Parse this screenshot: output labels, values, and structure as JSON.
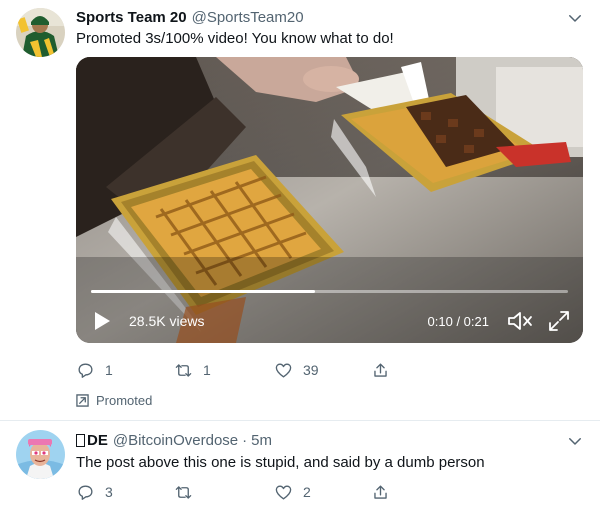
{
  "tweets": [
    {
      "author_name": "Sports Team 20",
      "author_handle": "@SportsTeam20",
      "text": "Promoted 3s/100% video! You know what to do!",
      "video": {
        "views": "28.5K views",
        "time": "0:10 / 0:21",
        "progress": 0.47
      },
      "actions": {
        "reply_count": "1",
        "retweet_count": "1",
        "like_count": "39"
      },
      "promoted_label": "Promoted"
    },
    {
      "author_name": "DE",
      "author_handle": "@BitcoinOverdose",
      "separator": "·",
      "time": "5m",
      "text": "The post above this one is stupid, and said by a dumb person",
      "actions": {
        "reply_count": "3",
        "retweet_count": "",
        "like_count": "2"
      }
    }
  ],
  "icons": {
    "more": "chevron-down-icon",
    "reply": "reply-icon",
    "retweet": "retweet-icon",
    "like": "heart-icon",
    "share": "share-icon",
    "play": "play-icon",
    "mute": "mute-icon",
    "expand": "expand-icon",
    "promoted": "promoted-arrow-icon"
  },
  "colors": {
    "text_primary": "#0f1419",
    "text_secondary": "#536471",
    "divider": "#e6ecf0"
  }
}
